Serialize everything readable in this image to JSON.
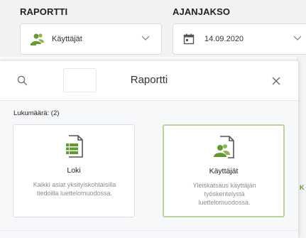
{
  "filters": {
    "report": {
      "label": "RAPORTTI",
      "selected": "Käyttäjät",
      "icon": "users-icon"
    },
    "period": {
      "label": "AJANJAKSO",
      "selected": "14.09.2020",
      "icon": "calendar-icon"
    }
  },
  "modal": {
    "title": "Raportti",
    "search": {
      "value": "",
      "placeholder": ""
    },
    "count_label": "Lukumäärä: (2)",
    "cards": [
      {
        "title": "Loki",
        "description": "Kaikki asiat yksityiskohtaisilla tiedoilla luettelomuodossa.",
        "icon": "list-document-icon",
        "selected": false
      },
      {
        "title": "Käyttäjät",
        "description": "Yleiskatsaus käyttäjän työskentelystä luettelomuodossa.",
        "icon": "users-document-icon",
        "selected": true
      }
    ]
  },
  "background": {
    "edge_letter": "K"
  },
  "colors": {
    "accent_green": "#6a9a2e",
    "selected_border": "#b9d49a",
    "top_bar_bg": "#f0f2f4"
  }
}
